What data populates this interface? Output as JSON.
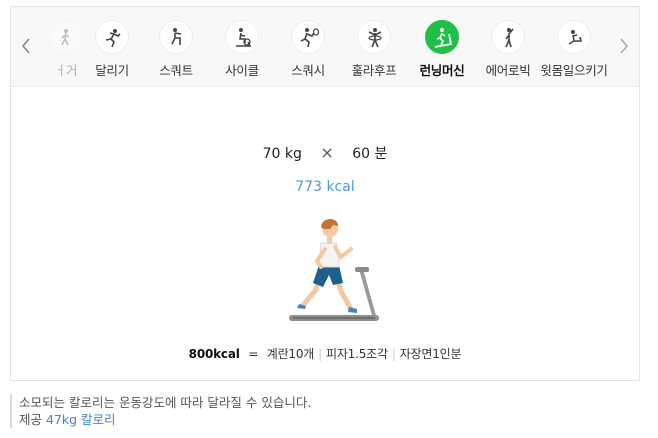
{
  "tabs": [
    {
      "label": "걷기",
      "icon": "walking-icon",
      "visible_label": "ㅓ거"
    },
    {
      "label": "달리기",
      "icon": "running-icon"
    },
    {
      "label": "스쿼트",
      "icon": "squat-icon"
    },
    {
      "label": "사이클",
      "icon": "cycling-icon"
    },
    {
      "label": "스쿼시",
      "icon": "squash-icon"
    },
    {
      "label": "훌라후프",
      "icon": "hula-hoop-icon"
    },
    {
      "label": "런닝머신",
      "icon": "treadmill-icon",
      "active": true
    },
    {
      "label": "에어로빅",
      "icon": "aerobics-icon"
    },
    {
      "label": "윗몸일으키기",
      "icon": "situp-icon"
    }
  ],
  "calc": {
    "weight": "70 kg",
    "times_symbol": "×",
    "duration": "60 분",
    "result": "773 kcal"
  },
  "equivalents": {
    "base": "800kcal",
    "equals": "=",
    "items": [
      "계란10개",
      "피자1.5조각",
      "자장면1인분"
    ]
  },
  "notes": {
    "line1": "소모되는 칼로리는 운동강도에 따라 달라질 수 있습니다.",
    "provider_prefix": "제공",
    "provider_value": "47kg 칼로리"
  },
  "colors": {
    "active_tab": "#1dc149",
    "kcal_text": "#4b9bd1",
    "link_text": "#4b82c9"
  }
}
